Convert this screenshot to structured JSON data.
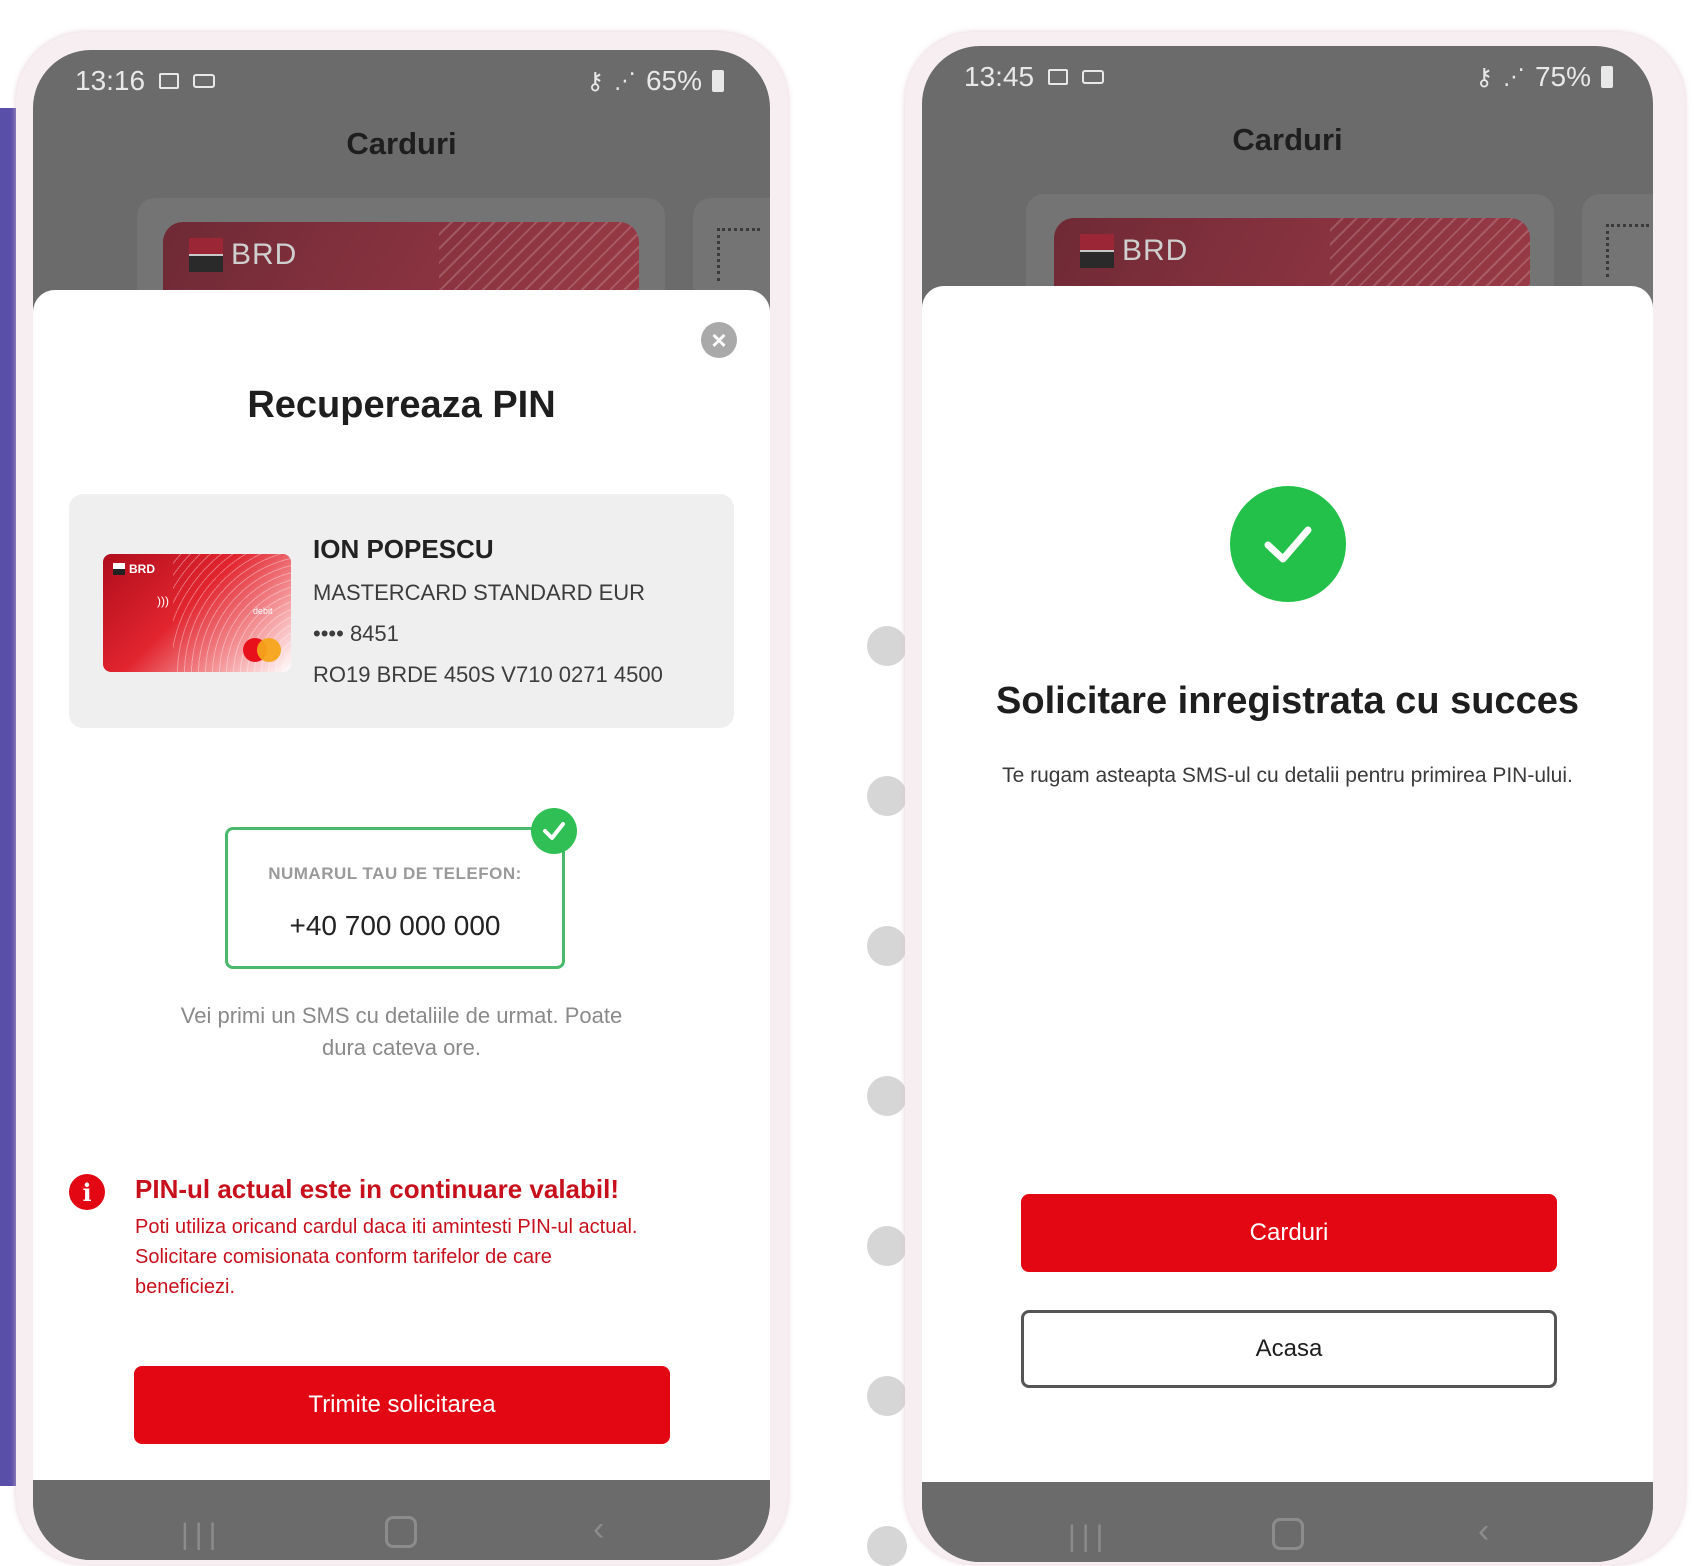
{
  "left_screen": {
    "status": {
      "time": "13:16",
      "battery": "65%"
    },
    "header": {
      "title": "Carduri"
    },
    "card_peek": {
      "brand": "BRD"
    },
    "sheet": {
      "title": "Recupereaza PIN",
      "card": {
        "brand": "BRD",
        "holder": "ION POPESCU",
        "product": "MASTERCARD STANDARD EUR",
        "number_dots": "••••",
        "number_last4": "8451",
        "iban": "RO19 BRDE 450S V710 0271 4500",
        "thumb_label": "debit"
      },
      "phone": {
        "label": "NUMARUL TAU DE TELEFON:",
        "value": "+40 700 000 000"
      },
      "hint_line1": "Vei primi un SMS cu detaliile de urmat. Poate",
      "hint_line2": "dura cateva ore.",
      "warning": {
        "title": "PIN-ul actual este in continuare valabil!",
        "line1": "Poti utiliza oricand cardul daca iti amintesti PIN-ul actual.",
        "line2": "Solicitare comisionata conform tarifelor de care",
        "line3": "beneficiezi."
      },
      "submit_label": "Trimite solicitarea"
    }
  },
  "right_screen": {
    "status": {
      "time": "13:45",
      "battery": "75%"
    },
    "header": {
      "title": "Carduri"
    },
    "card_peek": {
      "brand": "BRD"
    },
    "sheet": {
      "title": "Solicitare inregistrata cu succes",
      "subtitle": "Te rugam asteapta SMS-ul cu detalii pentru primirea PIN-ului.",
      "primary_label": "Carduri",
      "secondary_label": "Acasa"
    }
  },
  "colors": {
    "accent_red": "#e30613",
    "success_green": "#24c14a",
    "frame_tint": "#f7eef2"
  }
}
